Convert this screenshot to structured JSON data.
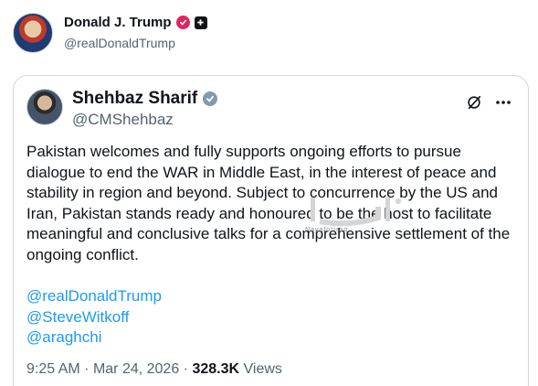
{
  "outer_post": {
    "name": "Donald J. Trump",
    "handle": "@realDonaldTrump"
  },
  "quoted_post": {
    "name": "Shehbaz Sharif",
    "handle": "@CMShehbaz",
    "body": "Pakistan welcomes and fully supports ongoing efforts to pursue dialogue to end the WAR in Middle East, in the interest of peace and stability in region and beyond. Subject to concurrence by the US and Iran, Pakistan stands ready and honoured to be the host to facilitate meaningful and conclusive talks for a comprehensive settlement of the ongoing conflict.",
    "mentions": [
      "@realDonaldTrump",
      "@SteveWitkoff",
      "@araghchi"
    ],
    "time": "9:25 AM",
    "date": "Mar 24, 2026",
    "views_count": "328.3K",
    "views_label": "Views"
  },
  "watermark": {
    "text": "Nayaforiraq"
  },
  "colors": {
    "link": "#1d9bf0",
    "muted": "#536471",
    "badge_pink": "#e0245e",
    "badge_grey": "#829aab"
  }
}
